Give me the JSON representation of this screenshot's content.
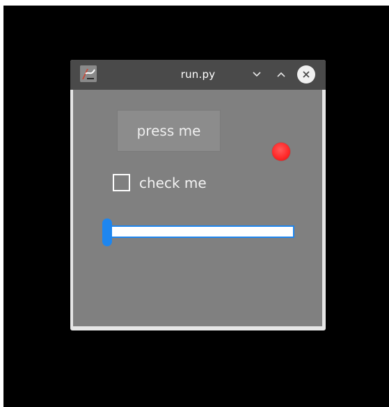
{
  "window": {
    "title": "run.py",
    "app_icon": "python-matplotlib-icon",
    "controls": [
      "minimize-icon",
      "maximize-icon",
      "close-icon"
    ]
  },
  "content": {
    "button": {
      "label": "press me"
    },
    "indicator": {
      "state": "on",
      "color": "#ff2a2a"
    },
    "checkbox": {
      "label": "check me",
      "checked": false
    },
    "slider": {
      "value": 0.0,
      "accent": "#1e86ef"
    }
  }
}
